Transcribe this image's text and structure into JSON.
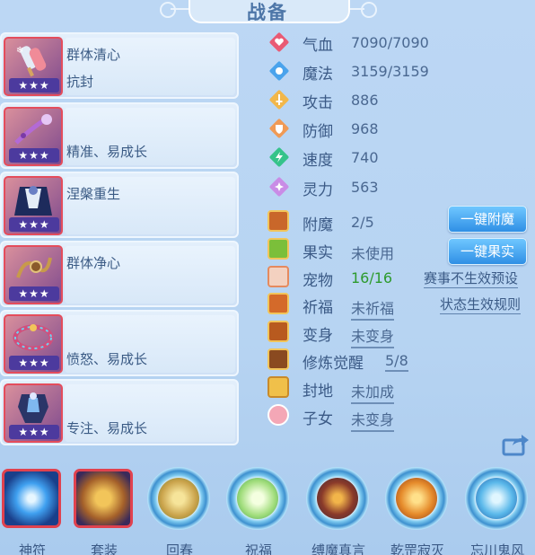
{
  "title": "战备",
  "items": [
    {
      "label": "群体清心",
      "sub": "抗封",
      "stars": "★★★",
      "icon": "ice-pop-icon",
      "color": "#d9dfe9"
    },
    {
      "label": "",
      "sub": "精准、易成长",
      "stars": "★★★",
      "icon": "purple-staff-icon",
      "color": "#7a3aa6"
    },
    {
      "label": "涅槃重生",
      "sub": "",
      "stars": "★★★",
      "icon": "dark-cloak-icon",
      "color": "#1d2b5c"
    },
    {
      "label": "群体净心",
      "sub": "",
      "stars": "★★★",
      "icon": "golden-chain-icon",
      "color": "#a9762e"
    },
    {
      "label": "",
      "sub": "愤怒、易成长",
      "stars": "★★★",
      "icon": "bead-bracelet-icon",
      "color": "#a64268"
    },
    {
      "label": "",
      "sub": "专注、易成长",
      "stars": "★★★",
      "icon": "dark-armor-icon",
      "color": "#2a3568"
    }
  ],
  "stats": [
    {
      "name": "气血",
      "value": "7090/7090",
      "icon": "heart-icon",
      "color": "#e95a74"
    },
    {
      "name": "魔法",
      "value": "3159/3159",
      "icon": "mana-icon",
      "color": "#4aa3ec"
    },
    {
      "name": "攻击",
      "value": "886",
      "icon": "sword-icon",
      "color": "#f2b74a"
    },
    {
      "name": "防御",
      "value": "968",
      "icon": "shield-icon",
      "color": "#f09a55"
    },
    {
      "name": "速度",
      "value": "740",
      "icon": "lightning-icon",
      "color": "#35c38a"
    },
    {
      "name": "灵力",
      "value": "563",
      "icon": "spirit-icon",
      "color": "#c98ce6"
    }
  ],
  "attrs": [
    {
      "name": "附魔",
      "value": "2/5",
      "icon": "enchant-icon"
    },
    {
      "name": "果实",
      "value": "未使用",
      "icon": "fruit-icon"
    },
    {
      "name": "宠物",
      "value": "16/16",
      "icon": "pet-icon"
    },
    {
      "name": "祈福",
      "value": "未祈福",
      "icon": "pray-icon"
    },
    {
      "name": "变身",
      "value": "未变身",
      "icon": "transform-icon"
    },
    {
      "name": "修炼觉醒",
      "value": "5/8",
      "icon": "cultivate-icon"
    },
    {
      "name": "封地",
      "value": "未加成",
      "icon": "fief-icon"
    },
    {
      "name": "子女",
      "value": "未变身",
      "icon": "child-icon"
    }
  ],
  "buttons": {
    "enchant": "一键附魔",
    "fruit": "一键果实"
  },
  "links": {
    "preset": "赛事不生效预设",
    "rules": "状态生效规则"
  },
  "skills": [
    {
      "label": "神符",
      "icon": "talisman-icon"
    },
    {
      "label": "套装",
      "icon": "armor-set-icon"
    },
    {
      "label": "回春",
      "icon": "rejuvenate-icon"
    },
    {
      "label": "祝福",
      "icon": "blessing-icon"
    },
    {
      "label": "缚魔真言",
      "icon": "bind-demon-icon"
    },
    {
      "label": "乾罡寂灭",
      "icon": "qiangang-icon"
    },
    {
      "label": "忘川鬼风",
      "icon": "ghost-wind-icon"
    }
  ]
}
